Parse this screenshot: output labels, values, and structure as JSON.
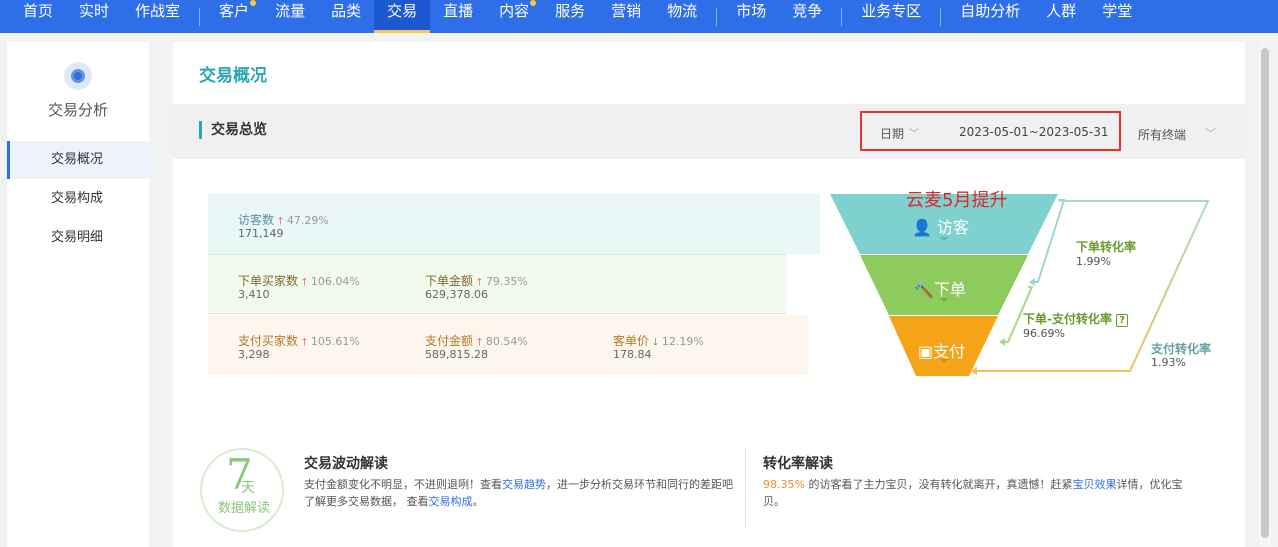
{
  "nav": {
    "items": [
      {
        "label": "首页"
      },
      {
        "label": "实时"
      },
      {
        "label": "作战室"
      },
      {
        "label": "客户",
        "dot": true
      },
      {
        "label": "流量"
      },
      {
        "label": "品类"
      },
      {
        "label": "交易",
        "active": true
      },
      {
        "label": "直播"
      },
      {
        "label": "内容",
        "dot": true
      },
      {
        "label": "服务"
      },
      {
        "label": "营销"
      },
      {
        "label": "物流"
      },
      {
        "label": "市场"
      },
      {
        "label": "竞争"
      },
      {
        "label": "业务专区"
      },
      {
        "label": "自助分析"
      },
      {
        "label": "人群"
      },
      {
        "label": "学堂"
      }
    ]
  },
  "sidebar": {
    "title": "交易分析",
    "items": [
      {
        "label": "交易概况",
        "active": true
      },
      {
        "label": "交易构成"
      },
      {
        "label": "交易明细"
      }
    ]
  },
  "page": {
    "title": "交易概况",
    "section_title": "交易总览",
    "date_label": "日期",
    "date_range": "2023-05-01~2023-05-31",
    "terminal": "所有终端"
  },
  "metrics": {
    "visitors": {
      "label": "访客数",
      "change": "47.29%",
      "value": "171,149",
      "trend": "up"
    },
    "order_buyers": {
      "label": "下单买家数",
      "change": "106.04%",
      "value": "3,410",
      "trend": "up"
    },
    "order_amount": {
      "label": "下单金额",
      "change": "79.35%",
      "value": "629,378.06",
      "trend": "up"
    },
    "pay_buyers": {
      "label": "支付买家数",
      "change": "105.61%",
      "value": "3,298",
      "trend": "up"
    },
    "pay_amount": {
      "label": "支付金额",
      "change": "80.54%",
      "value": "589,815.28",
      "trend": "up"
    },
    "unit_price": {
      "label": "客单价",
      "change": "12.19%",
      "value": "178.84",
      "trend": "down"
    }
  },
  "funnel": {
    "promo": "云麦5月提升",
    "stage_visitors": "访客",
    "stage_order": "下单",
    "stage_pay": "支付",
    "order_conv_label": "下单转化率",
    "order_conv_value": "1.99%",
    "order_pay_label": "下单-支付转化率",
    "order_pay_value": "96.69%",
    "pay_conv_label": "支付转化率",
    "pay_conv_value": "1.93%",
    "colors": {
      "visitors": "#7fd1cf",
      "order": "#8ccb5c",
      "pay": "#f5a318"
    }
  },
  "bottom": {
    "badge_num": "7",
    "badge_unit": "天",
    "badge_caption": "数据解读",
    "fluct_title": "交易波动解读",
    "fluct_text_1": "支付金额变化不明显，不进则退咧！查看",
    "fluct_link_1": "交易趋势",
    "fluct_text_2": "，进一步分析交易环节和同行的差距吧",
    "fluct_text_3": "了解更多交易数据，  查看",
    "fluct_link_2": "交易构成",
    "fluct_text_4": "。",
    "conv_title": "转化率解读",
    "conv_pct": "98.35%",
    "conv_text_1": " 的访客看了主力宝贝，没有转化就离开，真遗憾！赶紧",
    "conv_link": "宝贝效果",
    "conv_text_2": "详情，优化宝",
    "conv_text_3": "贝。"
  }
}
